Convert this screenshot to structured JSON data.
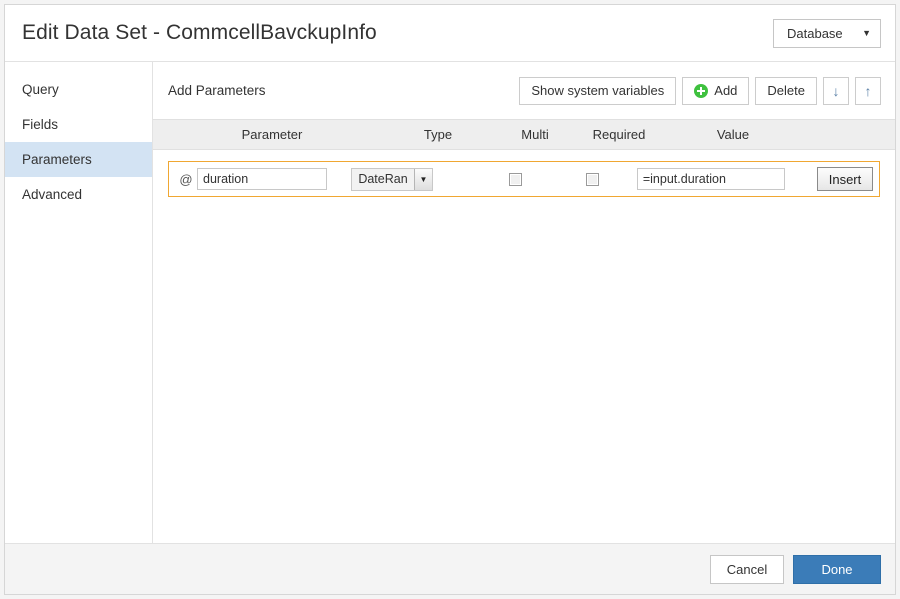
{
  "dialog": {
    "title": "Edit Data Set - CommcellBavckupInfo",
    "datasource": {
      "label": "Database",
      "caret_icon": "chevron-down-icon"
    }
  },
  "sidebar": {
    "items": [
      {
        "label": "Query",
        "active": false
      },
      {
        "label": "Fields",
        "active": false
      },
      {
        "label": "Parameters",
        "active": true
      },
      {
        "label": "Advanced",
        "active": false
      }
    ],
    "active_highlight_color": "#d3e3f3"
  },
  "main": {
    "section_label": "Add Parameters",
    "toolbar": {
      "show_system_variables_label": "Show system variables",
      "add_label": "Add",
      "add_icon": "plus-circle-icon",
      "delete_label": "Delete",
      "move_down_icon": "arrow-down-icon",
      "move_down_glyph": "↓",
      "move_up_icon": "arrow-up-icon",
      "move_up_glyph": "↑",
      "add_icon_color": "#3fc13f"
    },
    "table": {
      "headers": [
        "Parameter",
        "Type",
        "Multi",
        "Required",
        "Value"
      ],
      "rows": [
        {
          "prefix": "@",
          "parameter": "duration",
          "type": "DateRan",
          "type_caret": "▼",
          "multi_checked": false,
          "required_checked": false,
          "value": "=input.duration",
          "insert_label": "Insert",
          "selected_border_color": "#f0a732"
        }
      ]
    }
  },
  "footer": {
    "cancel_label": "Cancel",
    "done_label": "Done",
    "done_color": "#3b7cb8"
  }
}
